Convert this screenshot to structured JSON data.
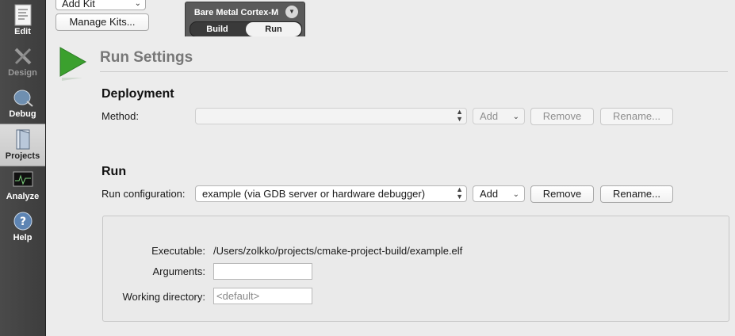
{
  "sidebar": {
    "modes": [
      {
        "label": "Edit",
        "icon": "edit-icon"
      },
      {
        "label": "Design",
        "icon": "design-icon"
      },
      {
        "label": "Debug",
        "icon": "debug-icon"
      },
      {
        "label": "Projects",
        "icon": "projects-icon"
      },
      {
        "label": "Analyze",
        "icon": "analyze-icon"
      },
      {
        "label": "Help",
        "icon": "help-icon"
      }
    ],
    "active": "Projects"
  },
  "toolbar": {
    "add_kit_label": "Add Kit",
    "manage_kits_label": "Manage Kits...",
    "kit_name": "Bare Metal Cortex-M",
    "tabs": [
      "Build",
      "Run"
    ],
    "selected_tab": "Run"
  },
  "page": {
    "title": "Run Settings",
    "deployment": {
      "heading": "Deployment",
      "method_label": "Method:",
      "method_value": "",
      "add_label": "Add",
      "remove_label": "Remove",
      "rename_label": "Rename..."
    },
    "run": {
      "heading": "Run",
      "config_label": "Run configuration:",
      "config_value": "example (via GDB server or hardware debugger)",
      "add_label": "Add",
      "remove_label": "Remove",
      "rename_label": "Rename..."
    },
    "details": {
      "executable_label": "Executable:",
      "executable_value": "/Users/zolkko/projects/cmake-project-build/example.elf",
      "arguments_label": "Arguments:",
      "arguments_value": "",
      "working_dir_label": "Working directory:",
      "working_dir_placeholder": "<default>"
    }
  },
  "colors": {
    "play_icon": "#3ba02e",
    "sidebar_bg": "#444444"
  }
}
